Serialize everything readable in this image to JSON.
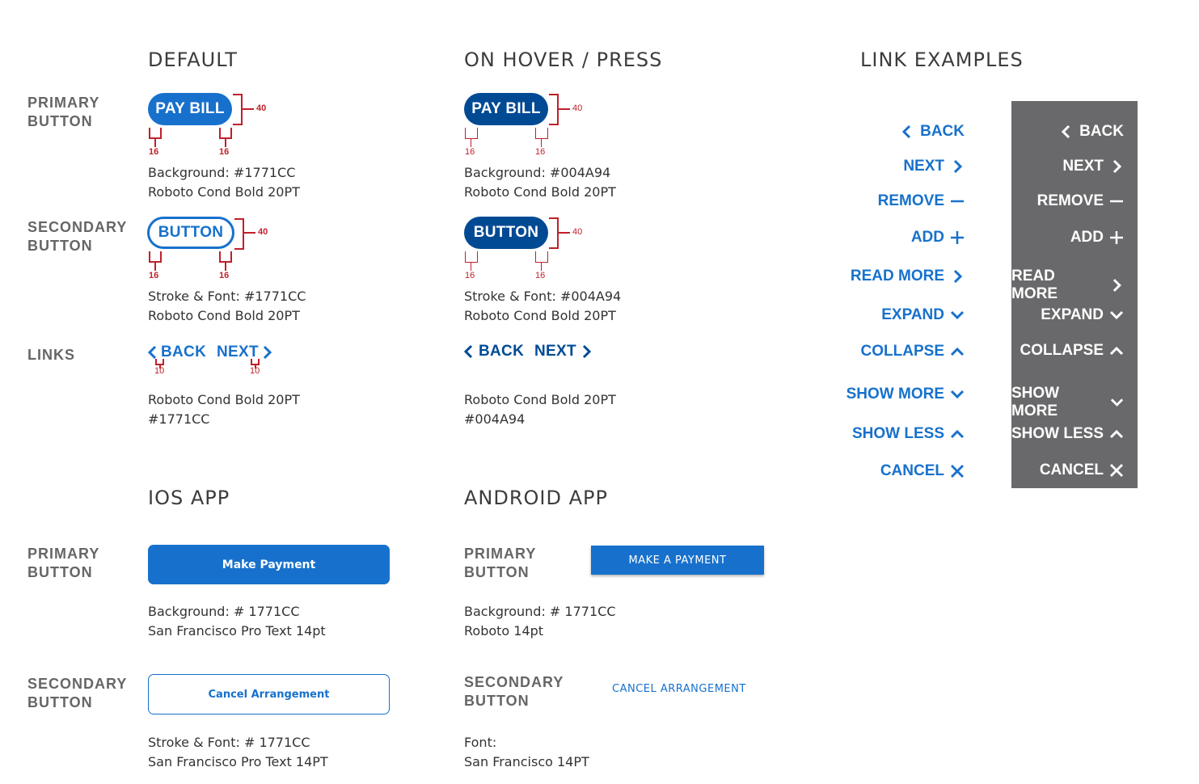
{
  "headings": {
    "default": "DEFAULT",
    "hover": "ON HOVER / PRESS",
    "link_examples": "LINK EXAMPLES",
    "ios": "IOS APP",
    "android": "ANDROID APP"
  },
  "row_labels": {
    "primary_1": "PRIMARY",
    "primary_2": "BUTTON",
    "secondary_1": "SECONDARY",
    "secondary_2": "BUTTON",
    "links": "LINKS"
  },
  "default": {
    "primary_label": "PAY BILL",
    "primary_desc_1": "Background: #1771CC",
    "primary_desc_2": "Roboto Cond Bold 20PT",
    "secondary_label": "BUTTON",
    "secondary_desc_1": "Stroke & Font: #1771CC",
    "secondary_desc_2": "Roboto Cond Bold 20PT",
    "back": "BACK",
    "next": "NEXT",
    "links_desc_1": "Roboto Cond Bold 20PT",
    "links_desc_2": "#1771CC"
  },
  "hover": {
    "primary_label": "PAY BILL",
    "primary_desc_1": "Background: #004A94",
    "primary_desc_2": "Roboto Cond Bold 20PT",
    "secondary_label": "BUTTON",
    "secondary_desc_1": "Stroke & Font: #004A94",
    "secondary_desc_2": "Roboto Cond Bold 20PT",
    "back": "BACK",
    "next": "NEXT",
    "links_desc_1": "Roboto Cond Bold 20PT",
    "links_desc_2": "#004A94"
  },
  "annotations": {
    "height": "40",
    "padding": "16",
    "gap": "10"
  },
  "link_examples": [
    {
      "label": "BACK",
      "icon": "chevron-left-icon"
    },
    {
      "label": "NEXT",
      "icon": "chevron-right-icon"
    },
    {
      "label": "REMOVE",
      "icon": "minus-icon"
    },
    {
      "label": "ADD",
      "icon": "plus-icon"
    },
    {
      "label": "READ MORE",
      "icon": "chevron-right-icon"
    },
    {
      "label": "EXPAND",
      "icon": "chevron-down-icon"
    },
    {
      "label": "COLLAPSE",
      "icon": "chevron-up-icon"
    },
    {
      "label": "SHOW MORE",
      "icon": "chevron-down-icon"
    },
    {
      "label": "SHOW LESS",
      "icon": "chevron-up-icon"
    },
    {
      "label": "CANCEL",
      "icon": "close-icon"
    }
  ],
  "ios": {
    "primary_label": "Make Payment",
    "primary_desc_1": "Background: # 1771CC",
    "primary_desc_2": "San Francisco Pro Text 14pt",
    "secondary_label": "Cancel Arrangement",
    "secondary_desc_1": "Stroke & Font: # 1771CC",
    "secondary_desc_2": "San Francisco Pro Text 14PT"
  },
  "android": {
    "primary_row_1": "PRIMARY",
    "primary_row_2": "BUTTON",
    "primary_label": "MAKE A PAYMENT",
    "primary_desc_1": "Background: # 1771CC",
    "primary_desc_2": "Roboto 14pt",
    "secondary_row_1": "SECONDARY",
    "secondary_row_2": "BUTTON",
    "secondary_label": "CANCEL ARRANGEMENT",
    "secondary_desc_1": "Font:",
    "secondary_desc_2": "San Francisco 14PT"
  },
  "colors": {
    "primary": "#1771CC",
    "pressed": "#004A94",
    "annotation": "#c0202a",
    "panel": "#69696b"
  }
}
